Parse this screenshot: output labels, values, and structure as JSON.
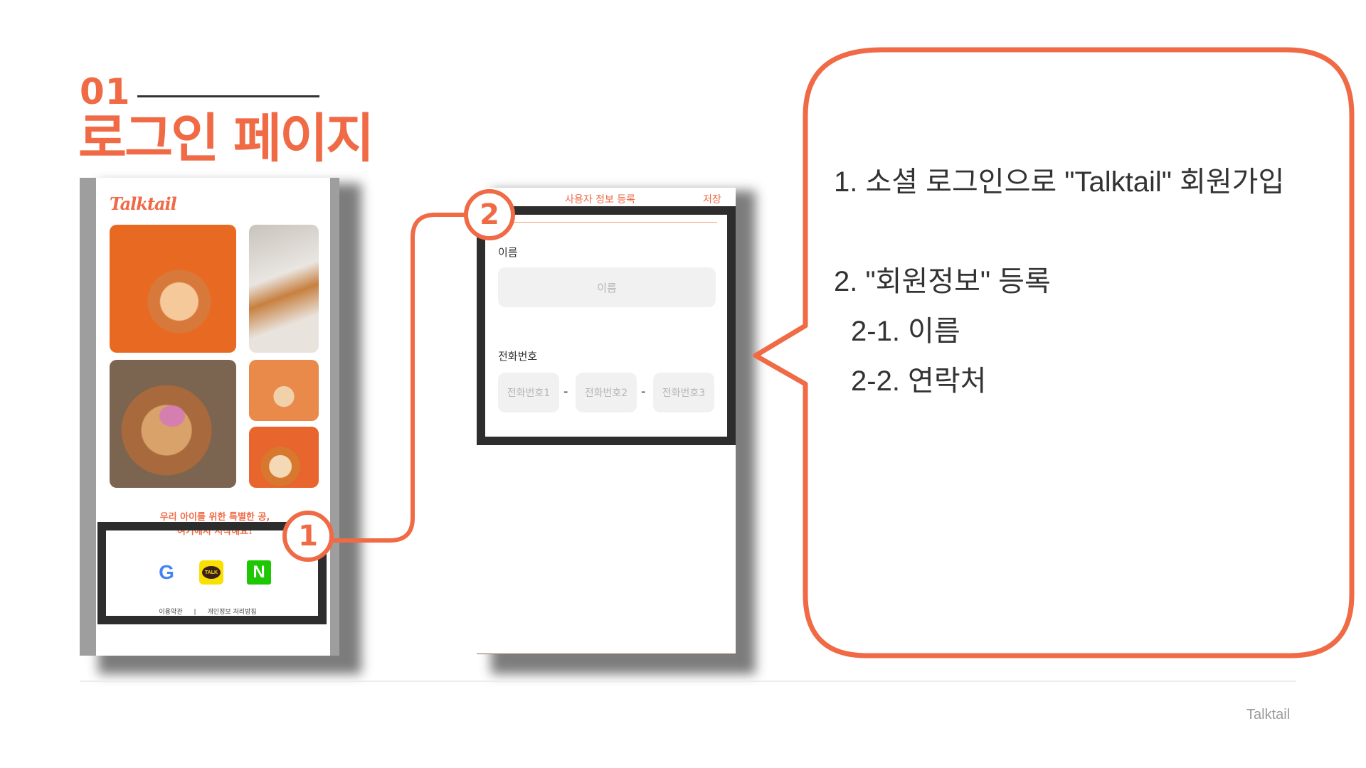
{
  "heading": {
    "number": "01",
    "title": "로그인 페이지"
  },
  "login_screen": {
    "logo": "Talktail",
    "tagline_line1": "우리 아이를 위한 특별한 공,",
    "tagline_line2": "여기에서 시작해요!",
    "social_buttons": {
      "google": "G",
      "kakao": "TALK",
      "naver": "N"
    },
    "footer_terms": "이용약관",
    "footer_separator": "|",
    "footer_privacy": "개인정보 처리방침"
  },
  "callouts": {
    "one": "1",
    "two": "2"
  },
  "register_screen": {
    "title": "사용자 정보 등록",
    "save_label": "저장",
    "name_label": "이름",
    "name_placeholder": "이름",
    "phone_label": "전화번호",
    "phone1_placeholder": "전화번호1",
    "phone2_placeholder": "전화번호2",
    "phone3_placeholder": "전화번호3",
    "dash": "-"
  },
  "description": {
    "line1": "1. 소셜 로그인으로 \"Talktail\" 회원가입",
    "line2": "2. \"회원정보\" 등록",
    "line3": "2-1. 이름",
    "line4": "2-2. 연락처"
  },
  "colors": {
    "accent": "#ef6a45",
    "frame": "#2d2d2d"
  },
  "footer": {
    "brand": "Talktail"
  }
}
